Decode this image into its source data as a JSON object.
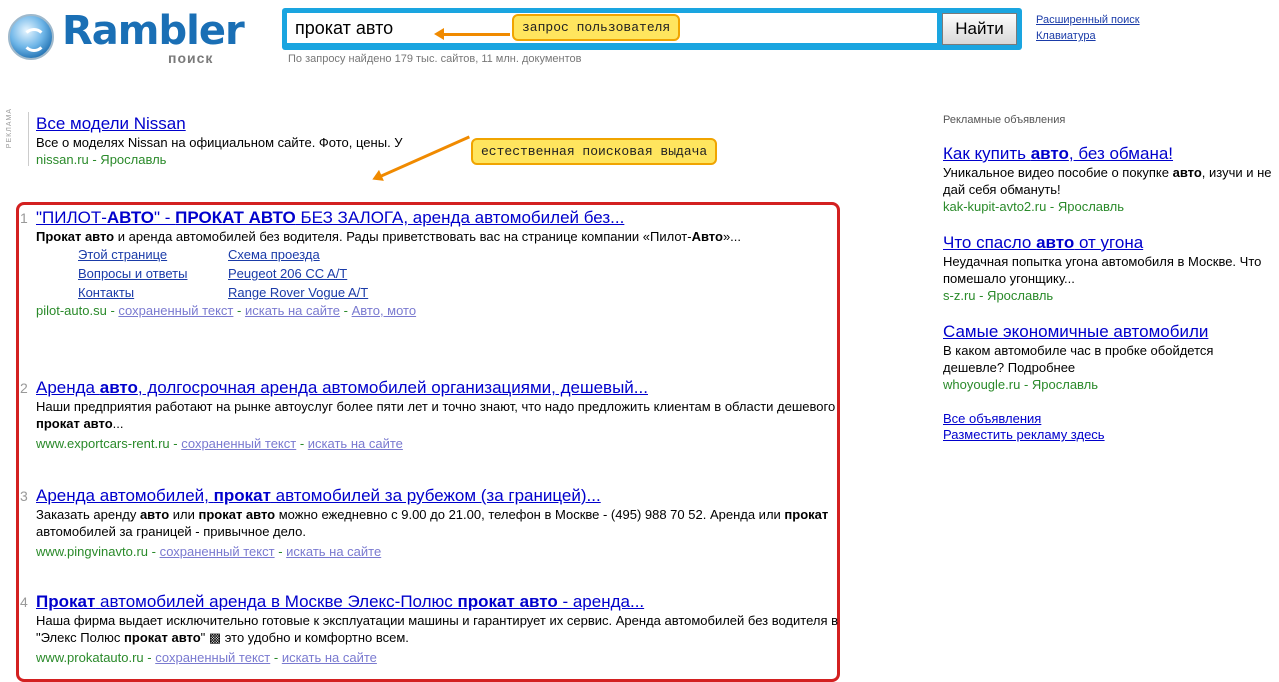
{
  "header": {
    "logo_text": "Rambler",
    "logo_sub": "поиск",
    "query": "прокат авто",
    "search_button": "Найти",
    "found_text": "По запросу найдено 179 тыс. сайтов, 11 млн. документов",
    "advanced_search": "Расширенный поиск",
    "keyboard": "Клавиатура"
  },
  "annotations": {
    "query_note": "запрос пользователя",
    "organic_note": "естественная поисковая выдача"
  },
  "top_ad": {
    "label": "РЕКЛАМА",
    "title": "Все модели Nissan",
    "snippet": "Все о моделях Nissan на официальном сайте. Фото, цены. У",
    "url": "nissan.ru - Ярославль"
  },
  "results": [
    {
      "num": "1",
      "title_parts": [
        {
          "t": "\"ПИЛОТ-",
          "b": false
        },
        {
          "t": "АВТО",
          "b": true
        },
        {
          "t": "\" - ",
          "b": false
        },
        {
          "t": "ПРОКАТ АВТО",
          "b": true
        },
        {
          "t": " БЕЗ ЗАЛОГА, аренда автомобилей без...",
          "b": false
        }
      ],
      "snippet_parts": [
        {
          "t": "Прокат авто",
          "b": true
        },
        {
          "t": " и аренда автомобилей без водителя. Рады приветствовать вас на странице компании «Пилот-",
          "b": false
        },
        {
          "t": "Авто",
          "b": true
        },
        {
          "t": "»...",
          "b": false
        }
      ],
      "sitelinks": [
        "Этой странице",
        "Схема проезда",
        "Вопросы и ответы",
        "Peugeot 206 CC A/T",
        "Контакты",
        "Range Rover Vogue A/T"
      ],
      "url": "pilot-auto.su",
      "extras": [
        "сохраненный текст",
        "искать на сайте",
        "Авто, мото"
      ]
    },
    {
      "num": "2",
      "title_parts": [
        {
          "t": "Аренда ",
          "b": false
        },
        {
          "t": "авто",
          "b": true
        },
        {
          "t": ", долгосрочная аренда автомобилей организациями, дешевый...",
          "b": false
        }
      ],
      "snippet_parts": [
        {
          "t": "Наши предприятия работают на рынке автоуслуг более пяти лет и точно знают, что надо предложить клиентам в области дешевого ",
          "b": false
        },
        {
          "t": "прокат авто",
          "b": true
        },
        {
          "t": "...",
          "b": false
        }
      ],
      "url": "www.exportcars-rent.ru",
      "extras": [
        "сохраненный текст",
        "искать на сайте"
      ]
    },
    {
      "num": "3",
      "title_parts": [
        {
          "t": "Аренда автомобилей, ",
          "b": false
        },
        {
          "t": "прокат",
          "b": true
        },
        {
          "t": " автомобилей за рубежом (за границей)...",
          "b": false
        }
      ],
      "snippet_parts": [
        {
          "t": "Заказать аренду ",
          "b": false
        },
        {
          "t": "авто",
          "b": true
        },
        {
          "t": " или ",
          "b": false
        },
        {
          "t": "прокат авто",
          "b": true
        },
        {
          "t": " можно ежедневно с 9.00 до 21.00, телефон в Москве - (495) 988 70 52. Аренда или ",
          "b": false
        },
        {
          "t": "прокат",
          "b": true
        },
        {
          "t": " автомобилей за границей - привычное дело.",
          "b": false
        }
      ],
      "url": "www.pingvinavto.ru",
      "extras": [
        "сохраненный текст",
        "искать на сайте"
      ]
    },
    {
      "num": "4",
      "title_parts": [
        {
          "t": "Прокат",
          "b": true
        },
        {
          "t": " автомобилей аренда в Москве Элекс-Полюс ",
          "b": false
        },
        {
          "t": "прокат авто",
          "b": true
        },
        {
          "t": " - аренда...",
          "b": false
        }
      ],
      "snippet_parts": [
        {
          "t": "Наша фирма выдает исключительно готовые к эксплуатации машины и гарантирует их сервис. Аренда автомобилей без водителя в \"Элекс Полюс ",
          "b": false
        },
        {
          "t": "прокат авто",
          "b": true
        },
        {
          "t": "\" ▩ это удобно и комфортно всем.",
          "b": false
        }
      ],
      "url": "www.prokatauto.ru",
      "extras": [
        "сохраненный текст",
        "искать на сайте"
      ]
    }
  ],
  "right_ads": {
    "header": "Рекламные объявления",
    "ads": [
      {
        "title_parts": [
          {
            "t": "Как купить ",
            "b": false
          },
          {
            "t": "авто",
            "b": true
          },
          {
            "t": ", без обмана!",
            "b": false
          }
        ],
        "text_parts": [
          {
            "t": "Уникальное видео пособие о покупке ",
            "b": false
          },
          {
            "t": "авто",
            "b": true
          },
          {
            "t": ", изучи и не дай себя обмануть!",
            "b": false
          }
        ],
        "url": "kak-kupit-avto2.ru - Ярославль"
      },
      {
        "title_parts": [
          {
            "t": "Что спасло ",
            "b": false
          },
          {
            "t": "авто",
            "b": true
          },
          {
            "t": " от угона",
            "b": false
          }
        ],
        "text_parts": [
          {
            "t": "Неудачная попытка угона автомобиля в Москве. Что помешало угонщику...",
            "b": false
          }
        ],
        "url": "s-z.ru - Ярославль"
      },
      {
        "title_parts": [
          {
            "t": "Самые экономичные автомобили",
            "b": false
          }
        ],
        "text_parts": [
          {
            "t": "В каком автомобиле час в пробке обойдется дешевле? Подробнее",
            "b": false
          }
        ],
        "url": "whoyougle.ru - Ярославль"
      }
    ],
    "all_ads": "Все объявления",
    "place_ad": "Разместить рекламу здесь"
  },
  "colors": {
    "search_frame": "#1aa5e0",
    "result_link": "#0000cc",
    "url_green": "#2a8a2a",
    "highlight_box": "#d32020",
    "note_fill": "#ffe55e"
  }
}
